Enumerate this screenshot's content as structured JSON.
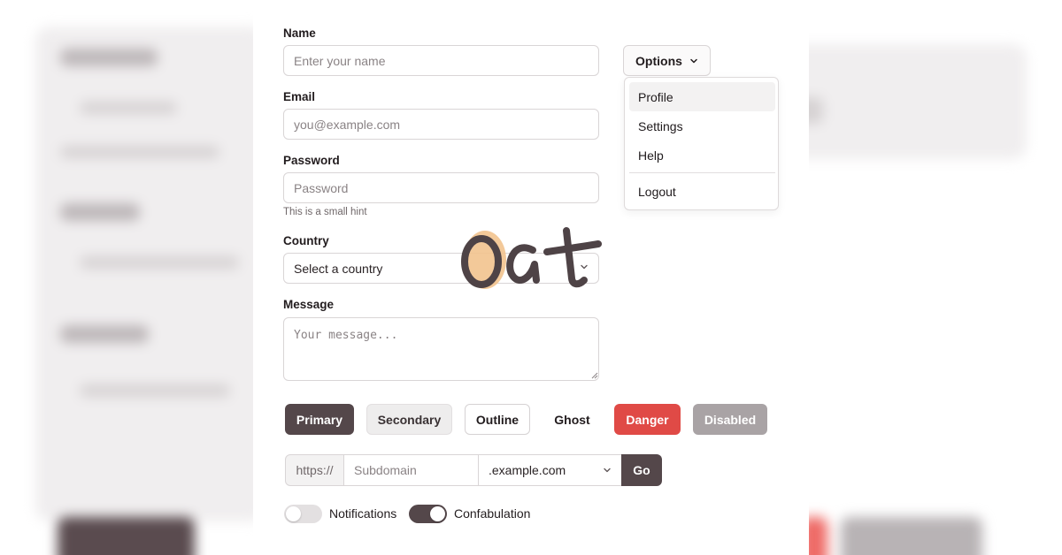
{
  "form": {
    "name_label": "Name",
    "name_placeholder": "Enter your name",
    "email_label": "Email",
    "email_placeholder": "you@example.com",
    "password_label": "Password",
    "password_placeholder": "Password",
    "password_hint": "This is a small hint",
    "country_label": "Country",
    "country_value": "Select a country",
    "message_label": "Message",
    "message_placeholder": "Your message..."
  },
  "logo": {
    "text": "oat"
  },
  "options": {
    "button_label": "Options",
    "menu_items": [
      "Profile",
      "Settings",
      "Help",
      "Logout"
    ],
    "highlighted_item": "Profile"
  },
  "buttons": {
    "primary": "Primary",
    "secondary": "Secondary",
    "outline": "Outline",
    "ghost": "Ghost",
    "danger": "Danger",
    "disabled": "Disabled"
  },
  "input_group": {
    "prefix": "https://",
    "subdomain_placeholder": "Subdomain",
    "domain_value": ".example.com",
    "go_label": "Go"
  },
  "toggles": [
    {
      "label": "Notifications",
      "on": false
    },
    {
      "label": "Confabulation",
      "on": true
    }
  ],
  "colors": {
    "primary": "#54474a",
    "danger": "#e04a46",
    "disabled": "#a9a3a5",
    "logo_accent": "#f2c38e",
    "logo_text": "#4e4346"
  }
}
